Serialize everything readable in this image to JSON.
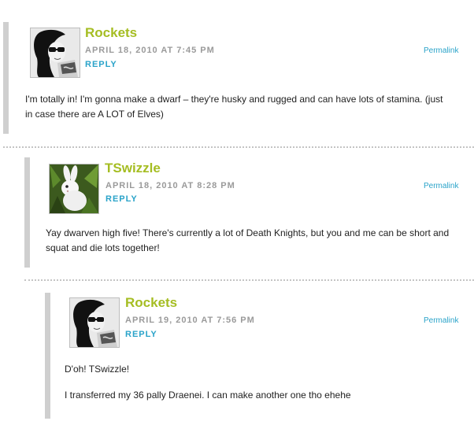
{
  "colors": {
    "author": "#a5bd22",
    "link": "#2aa3c9",
    "meta": "#9a9a9a",
    "bar": "#cfcfcf",
    "text": "#222222"
  },
  "comments": [
    {
      "author": "Rockets",
      "avatar_icon": "rockets-avatar-photo",
      "date": "APRIL 18, 2010 AT 7:45 PM",
      "reply_label": "REPLY",
      "permalink_label": "Permalink",
      "body": [
        "I'm totally in! I'm gonna make a dwarf – they're husky and rugged and can have lots of stamina. (just in case there are A LOT of Elves)"
      ]
    },
    {
      "author": "TSwizzle",
      "avatar_icon": "white-bunny-avatar-photo",
      "date": "APRIL 18, 2010 AT 8:28 PM",
      "reply_label": "REPLY",
      "permalink_label": "Permalink",
      "body": [
        "Yay dwarven high five! There's currently a lot of Death Knights, but you and me can be short and squat and die lots together!"
      ]
    },
    {
      "author": "Rockets",
      "avatar_icon": "rockets-avatar-photo",
      "date": "APRIL 19, 2010 AT 7:56 PM",
      "reply_label": "REPLY",
      "permalink_label": "Permalink",
      "body": [
        "D'oh! TSwizzle!",
        "I transferred my 36 pally Draenei. I can make another one tho ehehe"
      ]
    }
  ]
}
